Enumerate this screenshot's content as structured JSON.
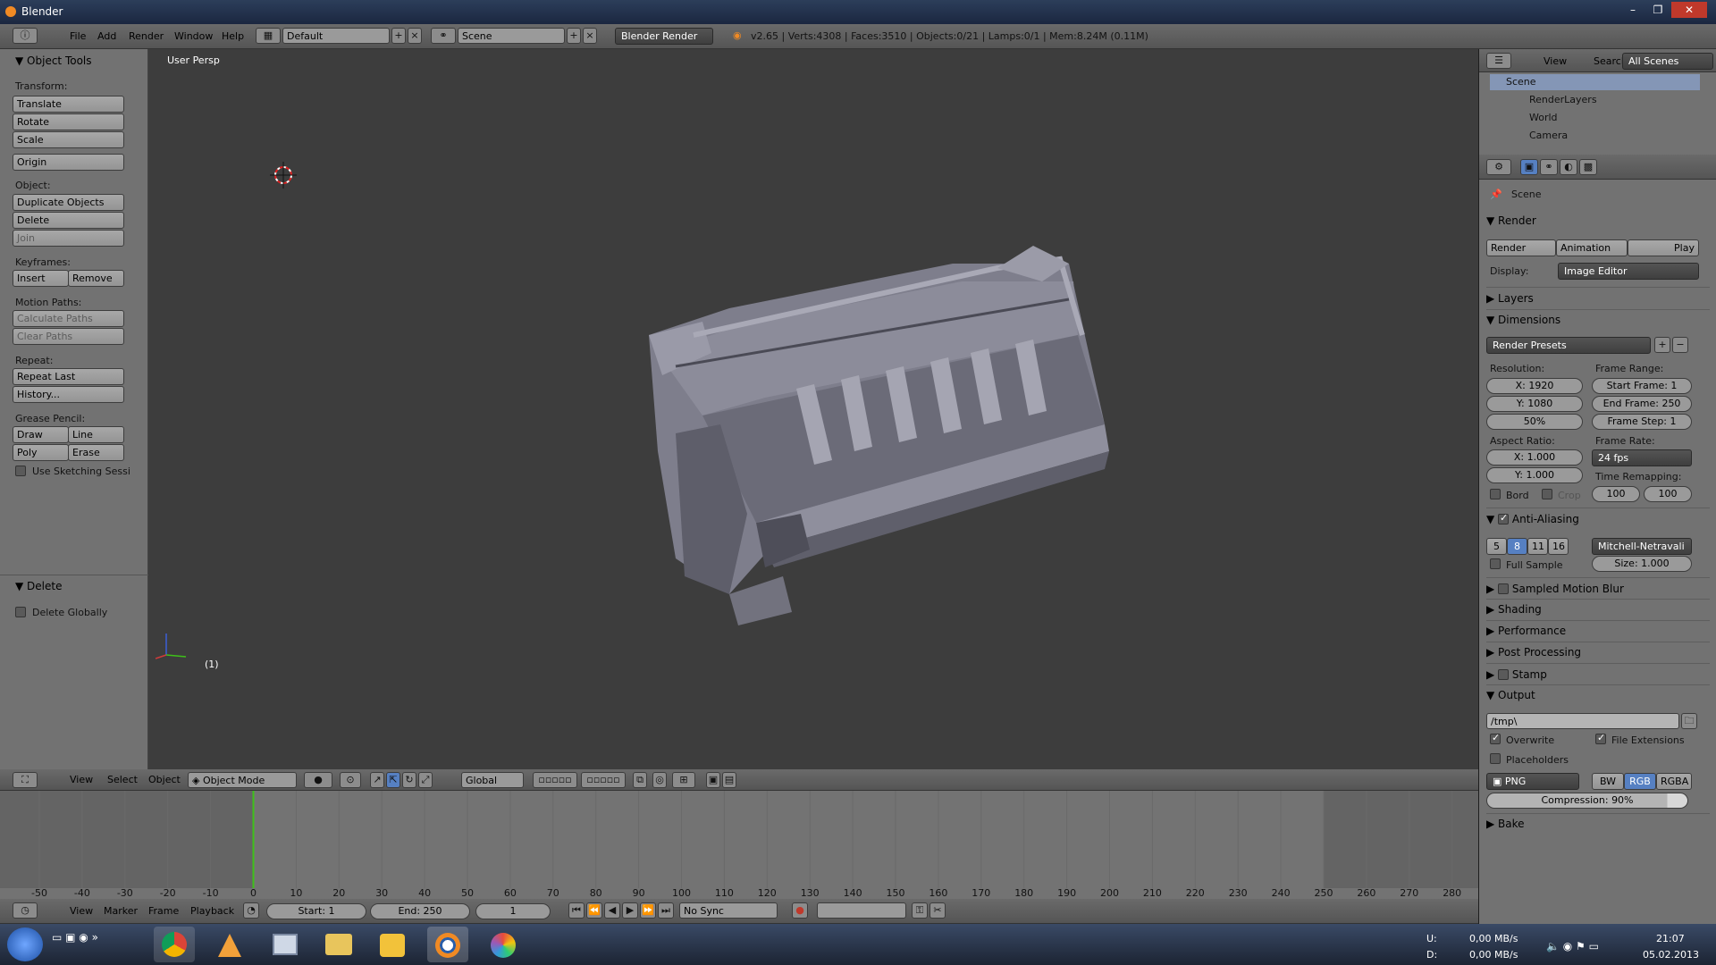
{
  "window": {
    "title": "Blender",
    "controls": [
      "–",
      "❐",
      "✕"
    ]
  },
  "info_header": {
    "menus": [
      "File",
      "Add",
      "Render",
      "Window",
      "Help"
    ],
    "layout": "Default",
    "scene": "Scene",
    "engine": "Blender Render",
    "stats": "v2.65 | Verts:4308 | Faces:3510 | Objects:0/21 | Lamps:0/1 | Mem:8.24M (0.11M)"
  },
  "toolshelf": {
    "title": "Object Tools",
    "transform_label": "Transform:",
    "translate": "Translate",
    "rotate": "Rotate",
    "scale": "Scale",
    "origin": "Origin",
    "object_label": "Object:",
    "duplicate": "Duplicate Objects",
    "delete": "Delete",
    "join": "Join",
    "keyframes_label": "Keyframes:",
    "insert": "Insert",
    "remove": "Remove",
    "motion_label": "Motion Paths:",
    "calc_paths": "Calculate Paths",
    "clear_paths": "Clear Paths",
    "repeat_label": "Repeat:",
    "repeat_last": "Repeat Last",
    "history": "History...",
    "grease_label": "Grease Pencil:",
    "draw": "Draw",
    "line": "Line",
    "poly": "Poly",
    "erase": "Erase",
    "sketching": "Use Sketching Sessi",
    "delete_panel": "Delete",
    "delete_globally": "Delete Globally"
  },
  "viewport": {
    "label": "User Persp",
    "frame": "(1)"
  },
  "view3d_header": {
    "menus": [
      "View",
      "Select",
      "Object"
    ],
    "mode": "Object Mode",
    "orientation": "Global"
  },
  "timeline": {
    "ticks": [
      "-50",
      "-40",
      "-30",
      "-20",
      "-10",
      "0",
      "10",
      "20",
      "30",
      "40",
      "50",
      "60",
      "70",
      "80",
      "90",
      "100",
      "110",
      "120",
      "130",
      "140",
      "150",
      "160",
      "170",
      "180",
      "190",
      "200",
      "210",
      "220",
      "230",
      "240",
      "250",
      "260",
      "270",
      "280"
    ],
    "menus": [
      "View",
      "Marker",
      "Frame",
      "Playback"
    ],
    "start": "Start: 1",
    "end": "End: 250",
    "current": "1",
    "sync": "No Sync",
    "current_frame_value": 0,
    "end_frame_value": 250
  },
  "outliner": {
    "menus": [
      "View",
      "Search"
    ],
    "filter": "All Scenes",
    "items": [
      "Scene",
      "RenderLayers",
      "World",
      "Camera"
    ]
  },
  "properties": {
    "context": "Scene",
    "render_panel": "Render",
    "render_btn": "Render",
    "animation_btn": "Animation",
    "play_btn": "Play",
    "display_label": "Display:",
    "display_value": "Image Editor",
    "layers_panel": "Layers",
    "dimensions_panel": "Dimensions",
    "render_presets": "Render Presets",
    "resolution_label": "Resolution:",
    "res_x": "X: 1920",
    "res_y": "Y: 1080",
    "res_pct": "50%",
    "frame_range_label": "Frame Range:",
    "start_frame": "Start Frame: 1",
    "end_frame": "End Frame: 250",
    "frame_step": "Frame Step: 1",
    "aspect_label": "Aspect Ratio:",
    "aspect_x": "X: 1.000",
    "aspect_y": "Y: 1.000",
    "frame_rate_label": "Frame Rate:",
    "frame_rate": "24 fps",
    "time_remap_label": "Time Remapping:",
    "remap_old": "100",
    "remap_new": "100",
    "bord": "Bord",
    "crop": "Crop",
    "aa_panel": "Anti-Aliasing",
    "aa_samples": [
      "5",
      "8",
      "11",
      "16"
    ],
    "aa_filter": "Mitchell-Netravali",
    "full_sample": "Full Sample",
    "aa_size": "Size: 1.000",
    "motion_blur": "Sampled Motion Blur",
    "shading": "Shading",
    "performance": "Performance",
    "post_processing": "Post Processing",
    "stamp": "Stamp",
    "output_panel": "Output",
    "output_path": "/tmp\\",
    "overwrite": "Overwrite",
    "file_ext": "File Extensions",
    "placeholders": "Placeholders",
    "format": "PNG",
    "bw": "BW",
    "rgb": "RGB",
    "rgba": "RGBA",
    "compression": "Compression: 90%",
    "bake": "Bake"
  },
  "taskbar": {
    "net_up_label": "U:",
    "net_down_label": "D:",
    "net_up": "0,00 MB/s",
    "net_down": "0,00 MB/s",
    "time": "21:07",
    "date": "05.02.2013"
  },
  "colors": {
    "accent": "#5680c2",
    "timeline_cursor": "#3ec01a",
    "viewport": "#3d3d3d"
  }
}
